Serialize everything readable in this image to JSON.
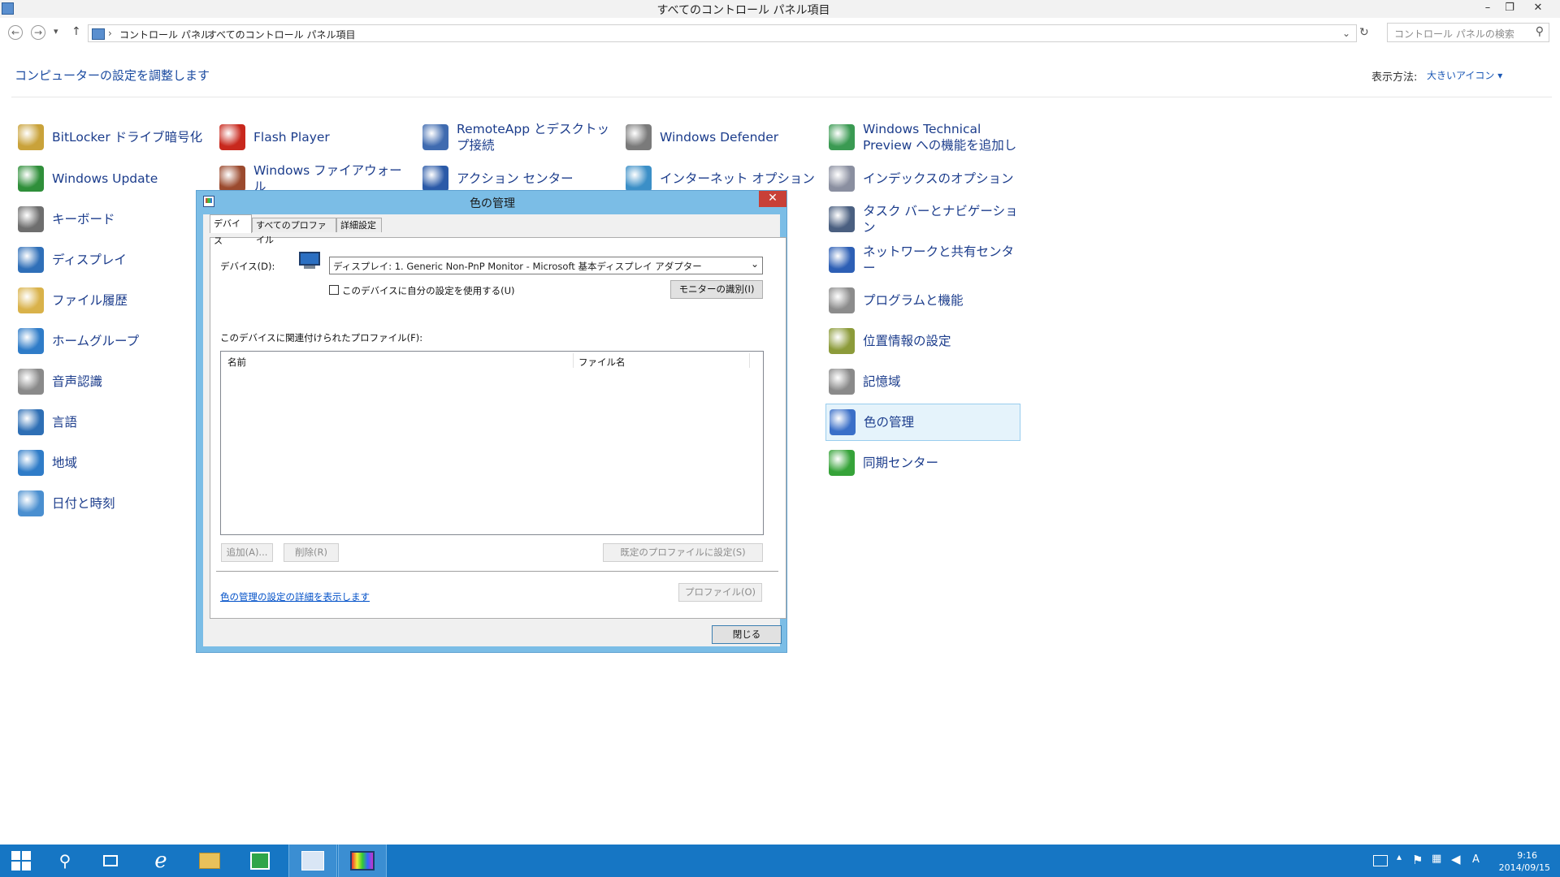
{
  "window": {
    "title": "すべてのコントロール パネル項目",
    "minimize": "–",
    "restore": "❐",
    "close": "✕"
  },
  "address": {
    "back": "←",
    "forward": "→",
    "up": "↑",
    "breadcrumb": [
      "コントロール パネル",
      "すべてのコントロール パネル項目"
    ],
    "separator": "›",
    "dropdown": "⌄",
    "refresh": "↻"
  },
  "search": {
    "placeholder": "コントロール パネルの検索",
    "icon": "⚲"
  },
  "heading": "コンピューターの設定を調整します",
  "view": {
    "label": "表示方法:",
    "value": "大きいアイコン ▾"
  },
  "items": [
    {
      "label": "BitLocker ドライブ暗号化",
      "icon": "bitlocker-icon",
      "color": "#c9a23a"
    },
    {
      "label": "Flash Player",
      "icon": "flash-player-icon",
      "color": "#c8281d"
    },
    {
      "label": "RemoteApp とデスクトップ接続",
      "icon": "remoteapp-icon",
      "color": "#3f6bb0"
    },
    {
      "label": "Windows Defender",
      "icon": "defender-icon",
      "color": "#7a7a7a"
    },
    {
      "label": "Windows Technical Preview への機能を追加しま",
      "icon": "add-features-icon",
      "color": "#3a9a52"
    },
    {
      "label": "Windows Update",
      "icon": "windows-update-icon",
      "color": "#2f8f3a"
    },
    {
      "label": "Windows ファイアウォール",
      "icon": "firewall-icon",
      "color": "#9b4a2e"
    },
    {
      "label": "アクション センター",
      "icon": "action-center-icon",
      "color": "#2b5aa8"
    },
    {
      "label": "インターネット オプション",
      "icon": "internet-options-icon",
      "color": "#3b8fc7"
    },
    {
      "label": "インデックスのオプション",
      "icon": "indexing-icon",
      "color": "#8a8fa0"
    },
    {
      "label": "キーボード",
      "icon": "keyboard-icon",
      "color": "#6e6e6e"
    },
    {
      "label": "タスク バーとナビゲーション",
      "icon": "taskbar-nav-icon",
      "color": "#4a5f80"
    },
    {
      "label": "ディスプレイ",
      "icon": "display-icon",
      "color": "#2f6fb8"
    },
    {
      "label": "ネットワークと共有センター",
      "icon": "network-icon",
      "color": "#2d5fb5"
    },
    {
      "label": "ファイル履歴",
      "icon": "file-history-icon",
      "color": "#d9b24a"
    },
    {
      "label": "プログラムと機能",
      "icon": "programs-icon",
      "color": "#8c8c8c"
    },
    {
      "label": "ホームグループ",
      "icon": "homegroup-icon",
      "color": "#2f7cc8"
    },
    {
      "label": "位置情報の設定",
      "icon": "location-icon",
      "color": "#8c9b3a"
    },
    {
      "label": "音声認識",
      "icon": "speech-icon",
      "color": "#8a8a8a"
    },
    {
      "label": "記憶域",
      "icon": "storage-icon",
      "color": "#8a8a8a"
    },
    {
      "label": "言語",
      "icon": "language-icon",
      "color": "#2e6fb5"
    },
    {
      "label": "色の管理",
      "icon": "color-management-icon",
      "color": "#3a6fc8"
    },
    {
      "label": "地域",
      "icon": "region-icon",
      "color": "#2f7cc8"
    },
    {
      "label": "同期センター",
      "icon": "sync-center-icon",
      "color": "#36a339"
    },
    {
      "label": "日付と時刻",
      "icon": "date-time-icon",
      "color": "#4a8fd0"
    }
  ],
  "dialog": {
    "title": "色の管理",
    "close": "✕",
    "tabs": [
      "デバイス",
      "すべてのプロファイル",
      "詳細設定"
    ],
    "device_label": "デバイス(D):",
    "device_value": "ディスプレイ: 1. Generic Non-PnP Monitor - Microsoft 基本ディスプレイ アダプター",
    "combo_arrow": "⌄",
    "use_my_settings": "このデバイスに自分の設定を使用する(U)",
    "identify_monitors": "モニターの識別(I)",
    "profiles_label": "このデバイスに関連付けられたプロファイル(F):",
    "columns": [
      "名前",
      "ファイル名"
    ],
    "add": "追加(A)...",
    "remove": "削除(R)",
    "set_default": "既定のプロファイルに設定(S)",
    "advanced_link": "色の管理の設定の詳細を表示します",
    "profiles_button": "プロファイル(O)",
    "close_button": "閉じる"
  },
  "taskbar": {
    "time": "9:16",
    "date": "2014/09/15",
    "ime": "A"
  }
}
